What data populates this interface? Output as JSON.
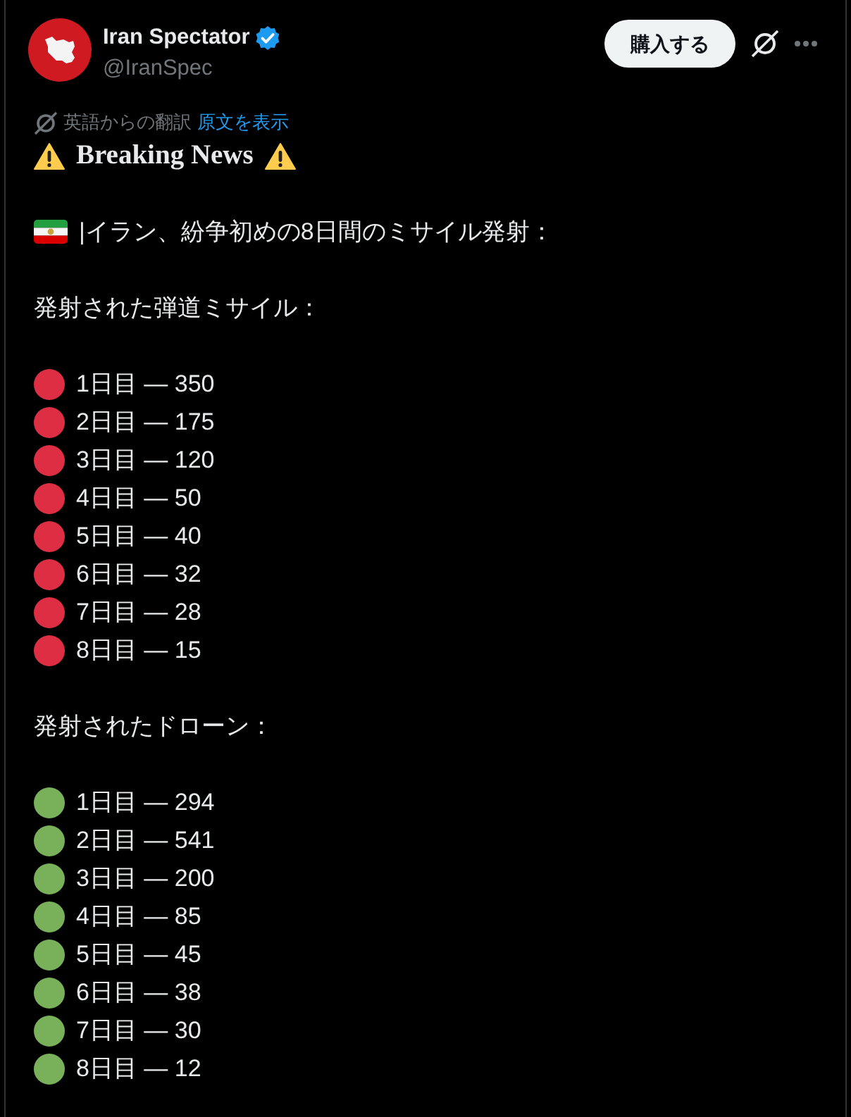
{
  "author": {
    "name": "Iran Spectator",
    "verified": true,
    "handle": "@IranSpec"
  },
  "header_actions": {
    "buy_button": "購入する"
  },
  "translation": {
    "label": "英語からの翻訳",
    "link": "原文を表示"
  },
  "post": {
    "headline": "Breaking News",
    "intro": "|イラン、紛争初めの8日間のミサイル発射：",
    "sections": [
      {
        "heading": "発射された弾道ミサイル：",
        "color": "#dd2e44",
        "items": [
          "1日目 — 350",
          "2日目 — 175",
          "3日目 — 120",
          "4日目 — 50",
          "5日目 — 40",
          "6日目 — 32",
          "7日目 — 28",
          "8日目 — 15"
        ]
      },
      {
        "heading": "発射されたドローン：",
        "color": "#78b159",
        "items": [
          "1日目 — 294",
          "2日目 — 541",
          "3日目 — 200",
          "4日目 — 85",
          "5日目 — 45",
          "6日目 — 38",
          "7日目 — 30",
          "8日目 — 12"
        ]
      }
    ]
  }
}
